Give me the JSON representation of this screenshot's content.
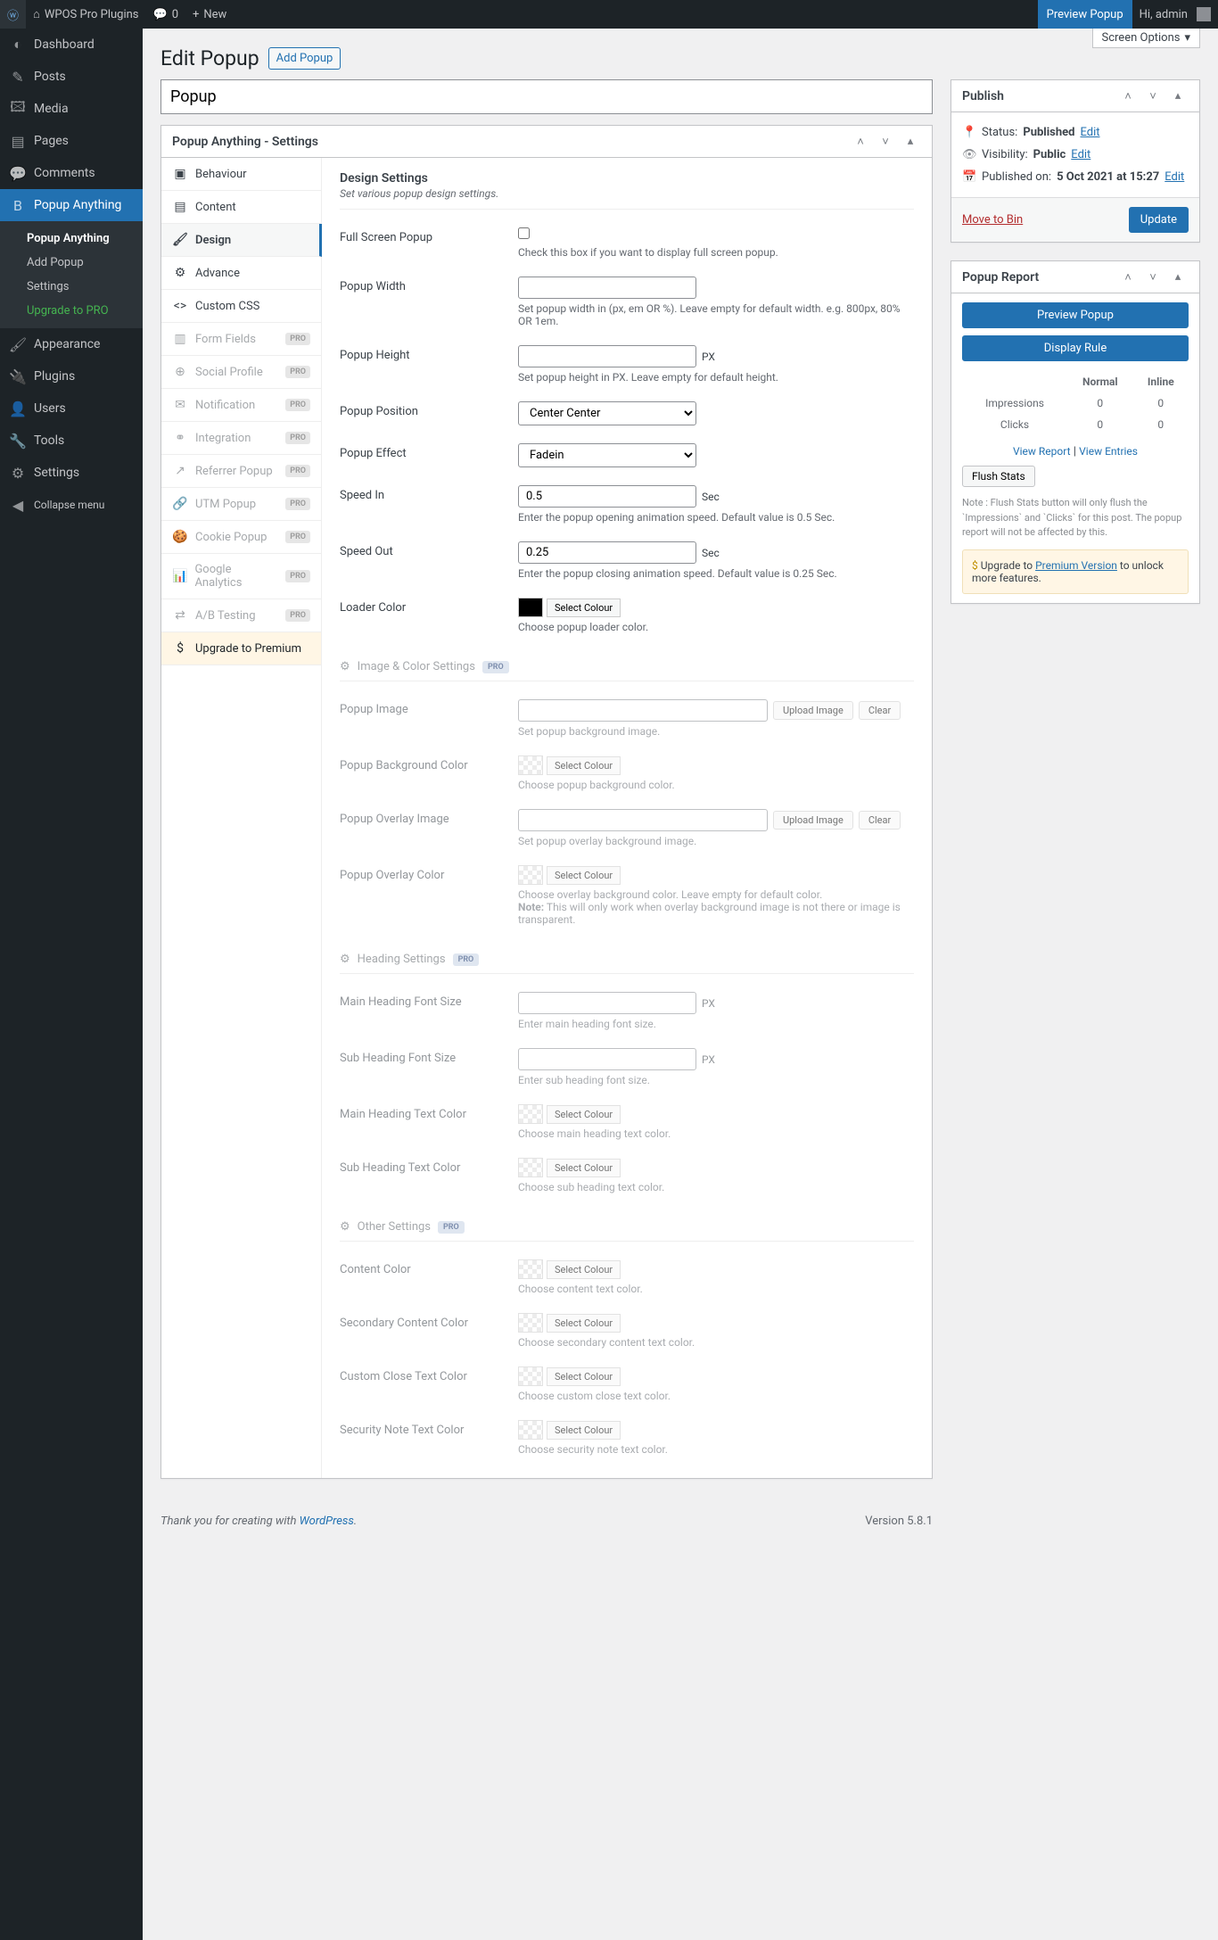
{
  "toolbar": {
    "site": "WPOS Pro Plugins",
    "comments": "0",
    "new": "New",
    "preview": "Preview Popup",
    "greeting": "Hi, admin"
  },
  "screenOptions": "Screen Options",
  "menu": [
    {
      "icon": "◐",
      "label": "Dashboard"
    },
    {
      "icon": "✎",
      "label": "Posts"
    },
    {
      "icon": "🖾",
      "label": "Media"
    },
    {
      "icon": "▤",
      "label": "Pages"
    },
    {
      "icon": "💬",
      "label": "Comments"
    },
    {
      "icon": "B",
      "label": "Popup Anything",
      "current": true,
      "sub": [
        {
          "label": "Popup Anything",
          "current": true
        },
        {
          "label": "Add Popup"
        },
        {
          "label": "Settings"
        },
        {
          "label": "Upgrade to PRO",
          "cls": "upgrade"
        }
      ]
    },
    {
      "icon": "🖌",
      "label": "Appearance"
    },
    {
      "icon": "🔌",
      "label": "Plugins"
    },
    {
      "icon": "👤",
      "label": "Users"
    },
    {
      "icon": "🔧",
      "label": "Tools"
    },
    {
      "icon": "⚙",
      "label": "Settings"
    },
    {
      "icon": "◀",
      "label": "Collapse menu",
      "collapse": true
    }
  ],
  "page": {
    "title": "Edit Popup",
    "addNew": "Add Popup",
    "postTitle": "Popup"
  },
  "metabox": {
    "title": "Popup Anything - Settings"
  },
  "tabs": [
    {
      "icon": "▣",
      "label": "Behaviour"
    },
    {
      "icon": "▤",
      "label": "Content"
    },
    {
      "icon": "🖌",
      "label": "Design",
      "active": true
    },
    {
      "icon": "⚙",
      "label": "Advance"
    },
    {
      "icon": "<>",
      "label": "Custom CSS"
    },
    {
      "icon": "▥",
      "label": "Form Fields",
      "pro": true
    },
    {
      "icon": "⊕",
      "label": "Social Profile",
      "pro": true
    },
    {
      "icon": "✉",
      "label": "Notification",
      "pro": true
    },
    {
      "icon": "⚭",
      "label": "Integration",
      "pro": true
    },
    {
      "icon": "↗",
      "label": "Referrer Popup",
      "pro": true
    },
    {
      "icon": "🔗",
      "label": "UTM Popup",
      "pro": true
    },
    {
      "icon": "🍪",
      "label": "Cookie Popup",
      "pro": true
    },
    {
      "icon": "📊",
      "label": "Google Analytics",
      "pro": true
    },
    {
      "icon": "⇄",
      "label": "A/B Testing",
      "pro": true
    },
    {
      "icon": "$",
      "label": "Upgrade to Premium",
      "upgrade": true
    }
  ],
  "design": {
    "heading": "Design Settings",
    "desc": "Set various popup design settings.",
    "fullScreen": {
      "label": "Full Screen Popup",
      "help": "Check this box if you want to display full screen popup."
    },
    "width": {
      "label": "Popup Width",
      "help": "Set popup width in (px, em OR %). Leave empty for default width. e.g. 800px, 80% OR 1em."
    },
    "height": {
      "label": "Popup Height",
      "unit": "PX",
      "help": "Set popup height in PX. Leave empty for default height."
    },
    "position": {
      "label": "Popup Position",
      "value": "Center Center"
    },
    "effect": {
      "label": "Popup Effect",
      "value": "Fadein"
    },
    "speedIn": {
      "label": "Speed In",
      "value": "0.5",
      "unit": "Sec",
      "help": "Enter the popup opening animation speed. Default value is 0.5 Sec."
    },
    "speedOut": {
      "label": "Speed Out",
      "value": "0.25",
      "unit": "Sec",
      "help": "Enter the popup closing animation speed. Default value is 0.25 Sec."
    },
    "loader": {
      "label": "Loader Color",
      "btn": "Select Colour",
      "help": "Choose popup loader color."
    },
    "imgSection": "Image & Color Settings",
    "popupImage": {
      "label": "Popup Image",
      "upload": "Upload Image",
      "clear": "Clear",
      "help": "Set popup background image."
    },
    "bgColor": {
      "label": "Popup Background Color",
      "btn": "Select Colour",
      "help": "Choose popup background color."
    },
    "overlayImage": {
      "label": "Popup Overlay Image",
      "upload": "Upload Image",
      "clear": "Clear",
      "help": "Set popup overlay background image."
    },
    "overlayColor": {
      "label": "Popup Overlay Color",
      "btn": "Select Colour",
      "help": "Choose overlay background color. Leave empty for default color.",
      "note": "Note:",
      "noteText": " This will only work when overlay background image is not there or image is transparent."
    },
    "headingSection": "Heading Settings",
    "mainHeadingSize": {
      "label": "Main Heading Font Size",
      "unit": "PX",
      "help": "Enter main heading font size."
    },
    "subHeadingSize": {
      "label": "Sub Heading Font Size",
      "unit": "PX",
      "help": "Enter sub heading font size."
    },
    "mainHeadingColor": {
      "label": "Main Heading Text Color",
      "btn": "Select Colour",
      "help": "Choose main heading text color."
    },
    "subHeadingColor": {
      "label": "Sub Heading Text Color",
      "btn": "Select Colour",
      "help": "Choose sub heading text color."
    },
    "otherSection": "Other Settings",
    "contentColor": {
      "label": "Content Color",
      "btn": "Select Colour",
      "help": "Choose content text color."
    },
    "secondaryColor": {
      "label": "Secondary Content Color",
      "btn": "Select Colour",
      "help": "Choose secondary content text color."
    },
    "closeColor": {
      "label": "Custom Close Text Color",
      "btn": "Select Colour",
      "help": "Choose custom close text color."
    },
    "securityColor": {
      "label": "Security Note Text Color",
      "btn": "Select Colour",
      "help": "Choose security note text color."
    },
    "pro": "PRO"
  },
  "publish": {
    "title": "Publish",
    "status": {
      "label": "Status:",
      "value": "Published",
      "edit": "Edit"
    },
    "visibility": {
      "label": "Visibility:",
      "value": "Public",
      "edit": "Edit"
    },
    "published": {
      "label": "Published on:",
      "value": "5 Oct 2021 at 15:27",
      "edit": "Edit"
    },
    "trash": "Move to Bin",
    "update": "Update"
  },
  "report": {
    "title": "Popup Report",
    "preview": "Preview Popup",
    "rule": "Display Rule",
    "cols": [
      "",
      "Normal",
      "Inline"
    ],
    "rows": [
      [
        "Impressions",
        "0",
        "0"
      ],
      [
        "Clicks",
        "0",
        "0"
      ]
    ],
    "viewReport": "View Report",
    "viewEntries": "View Entries",
    "flush": "Flush Stats",
    "note": "Note : Flush Stats button will only flush the `Impressions` and `Clicks` for this post. The popup report will not be affected by this.",
    "upgrade1": "Upgrade to ",
    "upgradeLink": "Premium Version",
    "upgrade2": " to unlock more features."
  },
  "footer": {
    "thank": "Thank you for creating with ",
    "wp": "WordPress",
    "version": "Version 5.8.1"
  }
}
